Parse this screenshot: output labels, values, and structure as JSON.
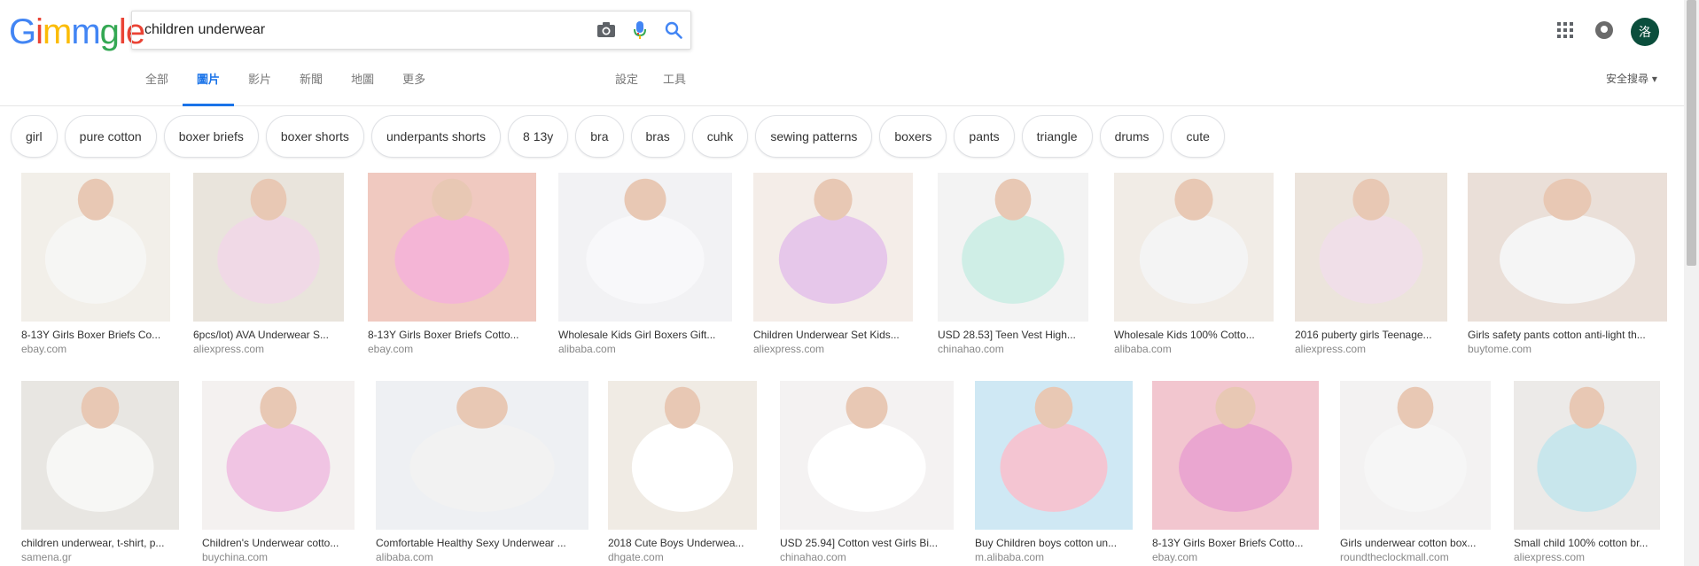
{
  "search": {
    "query": "children underwear"
  },
  "logo": [
    "G",
    "i",
    "m",
    "m",
    "g",
    "l",
    "e"
  ],
  "logo_colors": [
    "#4285f4",
    "#ea4335",
    "#fbbc05",
    "#4285f4",
    "#34a853",
    "#ea4335",
    "#ea4335"
  ],
  "avatar": {
    "initial": "洛",
    "color": "#0b4e3c"
  },
  "tabs": [
    {
      "label": "全部",
      "active": false
    },
    {
      "label": "圖片",
      "active": true
    },
    {
      "label": "影片",
      "active": false
    },
    {
      "label": "新聞",
      "active": false
    },
    {
      "label": "地圖",
      "active": false
    },
    {
      "label": "更多",
      "active": false
    }
  ],
  "tools": [
    {
      "label": "設定"
    },
    {
      "label": "工具"
    }
  ],
  "safe_search": "安全搜尋 ▾",
  "chips": [
    "girl",
    "pure cotton",
    "boxer briefs",
    "boxer shorts",
    "underpants shorts",
    "8 13y",
    "bra",
    "bras",
    "cuhk",
    "sewing patterns",
    "boxers",
    "pants",
    "triangle",
    "drums",
    "cute"
  ],
  "row1": [
    {
      "caption": "8-13Y Girls Boxer Briefs Co...",
      "source": "ebay.com",
      "bg": "#f2efe9",
      "fg": "#f6f6f4"
    },
    {
      "caption": "6pcs/lot) AVA Underwear S...",
      "source": "aliexpress.com",
      "bg": "#e9e4dc",
      "fg": "#f0d9e6"
    },
    {
      "caption": "8-13Y Girls Boxer Briefs Cotto...",
      "source": "ebay.com",
      "bg": "#f0c9c0",
      "fg": "#f4b5d6"
    },
    {
      "caption": "Wholesale Kids Girl Boxers Gift...",
      "source": "alibaba.com",
      "bg": "#f2f2f4",
      "fg": "#f8f8fa"
    },
    {
      "caption": "Children Underwear Set Kids...",
      "source": "aliexpress.com",
      "bg": "#f4ede8",
      "fg": "#e6c7ea"
    },
    {
      "caption": "USD 28.53] Teen Vest High...",
      "source": "chinahao.com",
      "bg": "#f3f3f3",
      "fg": "#cfeee6"
    },
    {
      "caption": "Wholesale Kids 100% Cotto...",
      "source": "alibaba.com",
      "bg": "#f1ece6",
      "fg": "#f4f4f4"
    },
    {
      "caption": "2016 puberty girls Teenage...",
      "source": "aliexpress.com",
      "bg": "#ece4dc",
      "fg": "#f0dfe8"
    },
    {
      "caption": "Girls safety pants cotton anti-light th...",
      "source": "buytome.com",
      "bg": "#eadfd8",
      "fg": "#f5f5f5"
    }
  ],
  "row2": [
    {
      "caption": "children underwear, t-shirt, p...",
      "source": "samena.gr",
      "bg": "#e8e6e2",
      "fg": "#f7f7f5"
    },
    {
      "caption": "Children's Underwear cotto...",
      "source": "buychina.com",
      "bg": "#f4f1f0",
      "fg": "#f0c4e3"
    },
    {
      "caption": "Comfortable Healthy Sexy Underwear ...",
      "source": "alibaba.com",
      "bg": "#eef0f3",
      "fg": "#f2f2f2"
    },
    {
      "caption": "2018 Cute Boys Underwea...",
      "source": "dhgate.com",
      "bg": "#f0ebe4",
      "fg": "#ffffff"
    },
    {
      "caption": "USD 25.94] Cotton vest Girls Bi...",
      "source": "chinahao.com",
      "bg": "#f4f2f2",
      "fg": "#ffffff"
    },
    {
      "caption": "Buy Children boys cotton un...",
      "source": "m.alibaba.com",
      "bg": "#cfe8f4",
      "fg": "#f4c5d2"
    },
    {
      "caption": "8-13Y Girls Boxer Briefs Cotto...",
      "source": "ebay.com",
      "bg": "#f2c6cf",
      "fg": "#eaa6d0"
    },
    {
      "caption": "Girls underwear cotton box...",
      "source": "roundtheclockmall.com",
      "bg": "#f3f2f2",
      "fg": "#f6f6f6"
    },
    {
      "caption": "Small child 100% cotton br...",
      "source": "aliexpress.com",
      "bg": "#eceae8",
      "fg": "#c8e6ec"
    }
  ]
}
